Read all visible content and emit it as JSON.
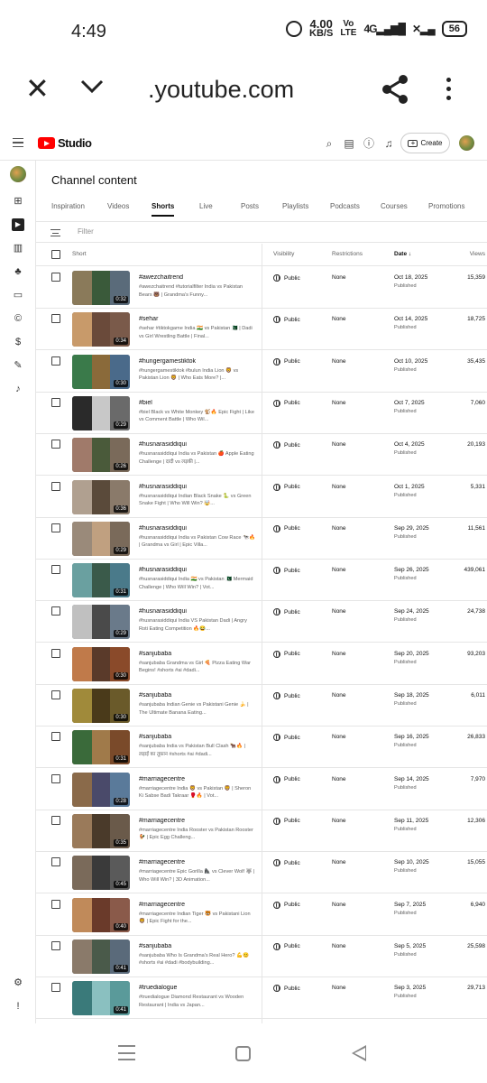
{
  "status_bar": {
    "time": "4:49",
    "speed_value": "4.00",
    "speed_unit": "KB/S",
    "volte_top": "Vo",
    "volte_bottom": "LTE",
    "signal": "4G",
    "battery": "56"
  },
  "browser": {
    "url": ".youtube.com"
  },
  "studio": {
    "logo_text": "Studio",
    "create_label": "Create",
    "page_title": "Channel content",
    "filter_placeholder": "Filter"
  },
  "tabs": [
    "Inspiration",
    "Videos",
    "Shorts",
    "Live",
    "Posts",
    "Playlists",
    "Podcasts",
    "Courses",
    "Promotions"
  ],
  "active_tab": "Shorts",
  "columns": {
    "short": "Short",
    "visibility": "Visibility",
    "restrictions": "Restrictions",
    "date": "Date ↓",
    "views": "Views"
  },
  "rows": [
    {
      "title": "#awezchaitrend",
      "desc": "#awezchaitrend #tutorialfilter India vs Pakistan Bears 🐻 | Grandma's Funny...",
      "duration": "0:32",
      "visibility": "Public",
      "restrictions": "None",
      "date": "Oct 18, 2025",
      "status": "Published",
      "views": "15,359"
    },
    {
      "title": "#sehar",
      "desc": "#sehar #tiktokgame India 🇮🇳 vs Pakistan 🇵🇰 | Dadi vs Girl Wrestling Battle | Final...",
      "duration": "0:34",
      "visibility": "Public",
      "restrictions": "None",
      "date": "Oct 14, 2025",
      "status": "Published",
      "views": "18,725"
    },
    {
      "title": "#hungergamestiktok",
      "desc": "#hungergamestiktok #bulun India Lion 🦁 vs Pakistan Lion 🦁 | Who Eats More? |...",
      "duration": "0:30",
      "visibility": "Public",
      "restrictions": "None",
      "date": "Oct 10, 2025",
      "status": "Published",
      "views": "35,435"
    },
    {
      "title": "#biel",
      "desc": "#biel Black vs White Monkey 🐒🔥 Epic Fight | Like vs Comment Battle | Who Wil...",
      "duration": "0:29",
      "visibility": "Public",
      "restrictions": "None",
      "date": "Oct 7, 2025",
      "status": "Published",
      "views": "7,060"
    },
    {
      "title": "#husnarasiddiqui",
      "desc": "#husnarasiddiqui India vs Pakistan 🍎 Apple Eating Challenge | दादी vs लड़की |...",
      "duration": "0:26",
      "visibility": "Public",
      "restrictions": "None",
      "date": "Oct 4, 2025",
      "status": "Published",
      "views": "20,193"
    },
    {
      "title": "#husnarasiddiqui",
      "desc": "#husnarasiddiqui Indian Black Snake 🐍 vs Green Snake Fight | Who Will Win? 🤯...",
      "duration": "0:36",
      "visibility": "Public",
      "restrictions": "None",
      "date": "Oct 1, 2025",
      "status": "Published",
      "views": "5,331"
    },
    {
      "title": "#husnarasiddiqui",
      "desc": "#husnarasiddiqui India vs Pakistan Cow Race 🐄🔥 | Grandma vs Girl | Epic Villa...",
      "duration": "0:29",
      "visibility": "Public",
      "restrictions": "None",
      "date": "Sep 29, 2025",
      "status": "Published",
      "views": "11,561"
    },
    {
      "title": "#husnarasiddiqui",
      "desc": "#husnarasiddiqui India 🇮🇳 vs Pakistan 🇵🇰 Mermaid Challenge | Who Will Win? | Vot...",
      "duration": "0:31",
      "visibility": "Public",
      "restrictions": "None",
      "date": "Sep 26, 2025",
      "status": "Published",
      "views": "439,061"
    },
    {
      "title": "#husnarasiddiqui",
      "desc": "#husnarasiddiqui India VS Pakistan Dadi | Angry Roti Eating Competition 🔥😂...",
      "duration": "0:29",
      "visibility": "Public",
      "restrictions": "None",
      "date": "Sep 24, 2025",
      "status": "Published",
      "views": "24,738"
    },
    {
      "title": "#sanjubaba",
      "desc": "#sanjubaba Grandma vs Girl 🍕 Pizza Eating War Begins! #shorts #ai #dadi...",
      "duration": "0:30",
      "visibility": "Public",
      "restrictions": "None",
      "date": "Sep 20, 2025",
      "status": "Published",
      "views": "93,203"
    },
    {
      "title": "#sanjubaba",
      "desc": "#sanjubaba Indian Genie vs Pakistani Genie 🍌 | The Ultimate Banana Eating...",
      "duration": "0:30",
      "visibility": "Public",
      "restrictions": "None",
      "date": "Sep 18, 2025",
      "status": "Published",
      "views": "6,011"
    },
    {
      "title": "#sanjubaba",
      "desc": "#sanjubaba India vs Pakistan Bull Clash 🐂🔥 | लड़ाई का तूफ़ान #shorts #ai #dadi...",
      "duration": "0:31",
      "visibility": "Public",
      "restrictions": "None",
      "date": "Sep 16, 2025",
      "status": "Published",
      "views": "26,833"
    },
    {
      "title": "#marriagecentre",
      "desc": "#marriagecentre India 🦁 vs Pakistan 🦁 | Sheron Ki Sabse Badi Takraar 🥊🔥 | Vot...",
      "duration": "0:28",
      "visibility": "Public",
      "restrictions": "None",
      "date": "Sep 14, 2025",
      "status": "Published",
      "views": "7,970"
    },
    {
      "title": "#marriagecentre",
      "desc": "#marriagecentre India Rooster vs Pakistan Rooster 🐓 | Epic Egg Challeng...",
      "duration": "0:35",
      "visibility": "Public",
      "restrictions": "None",
      "date": "Sep 11, 2025",
      "status": "Published",
      "views": "12,306"
    },
    {
      "title": "#marriagecentre",
      "desc": "#marriagecentre Epic Gorilla 🦍 vs Clever Wolf 🐺 | Who Will Win? | 3D Animation...",
      "duration": "0:45",
      "visibility": "Public",
      "restrictions": "None",
      "date": "Sep 10, 2025",
      "status": "Published",
      "views": "15,055"
    },
    {
      "title": "#marriagecentre",
      "desc": "#marriagecentre Indian Tiger 🐯 vs Pakistani Lion 🦁 | Epic Fight for the...",
      "duration": "0:40",
      "visibility": "Public",
      "restrictions": "None",
      "date": "Sep 7, 2025",
      "status": "Published",
      "views": "6,940"
    },
    {
      "title": "#sanjubaba",
      "desc": "#sanjubaba Who Is Grandma's Real Hero? 💪😊 #shorts #ai #dadi #bodybuilding...",
      "duration": "0:41",
      "visibility": "Public",
      "restrictions": "None",
      "date": "Sep 5, 2025",
      "status": "Published",
      "views": "25,598"
    },
    {
      "title": "#truedialogue",
      "desc": "#truedialogue Diamond Restaurant vs Wooden Restaurant | India vs Japan...",
      "duration": "0:41",
      "visibility": "Public",
      "restrictions": "None",
      "date": "Sep 3, 2025",
      "status": "Published",
      "views": "29,713"
    }
  ],
  "colors": {
    "youtube_red": "#ff0000",
    "text_primary": "#0f0f0f",
    "text_secondary": "#606060",
    "divider": "#e5e5e5"
  }
}
